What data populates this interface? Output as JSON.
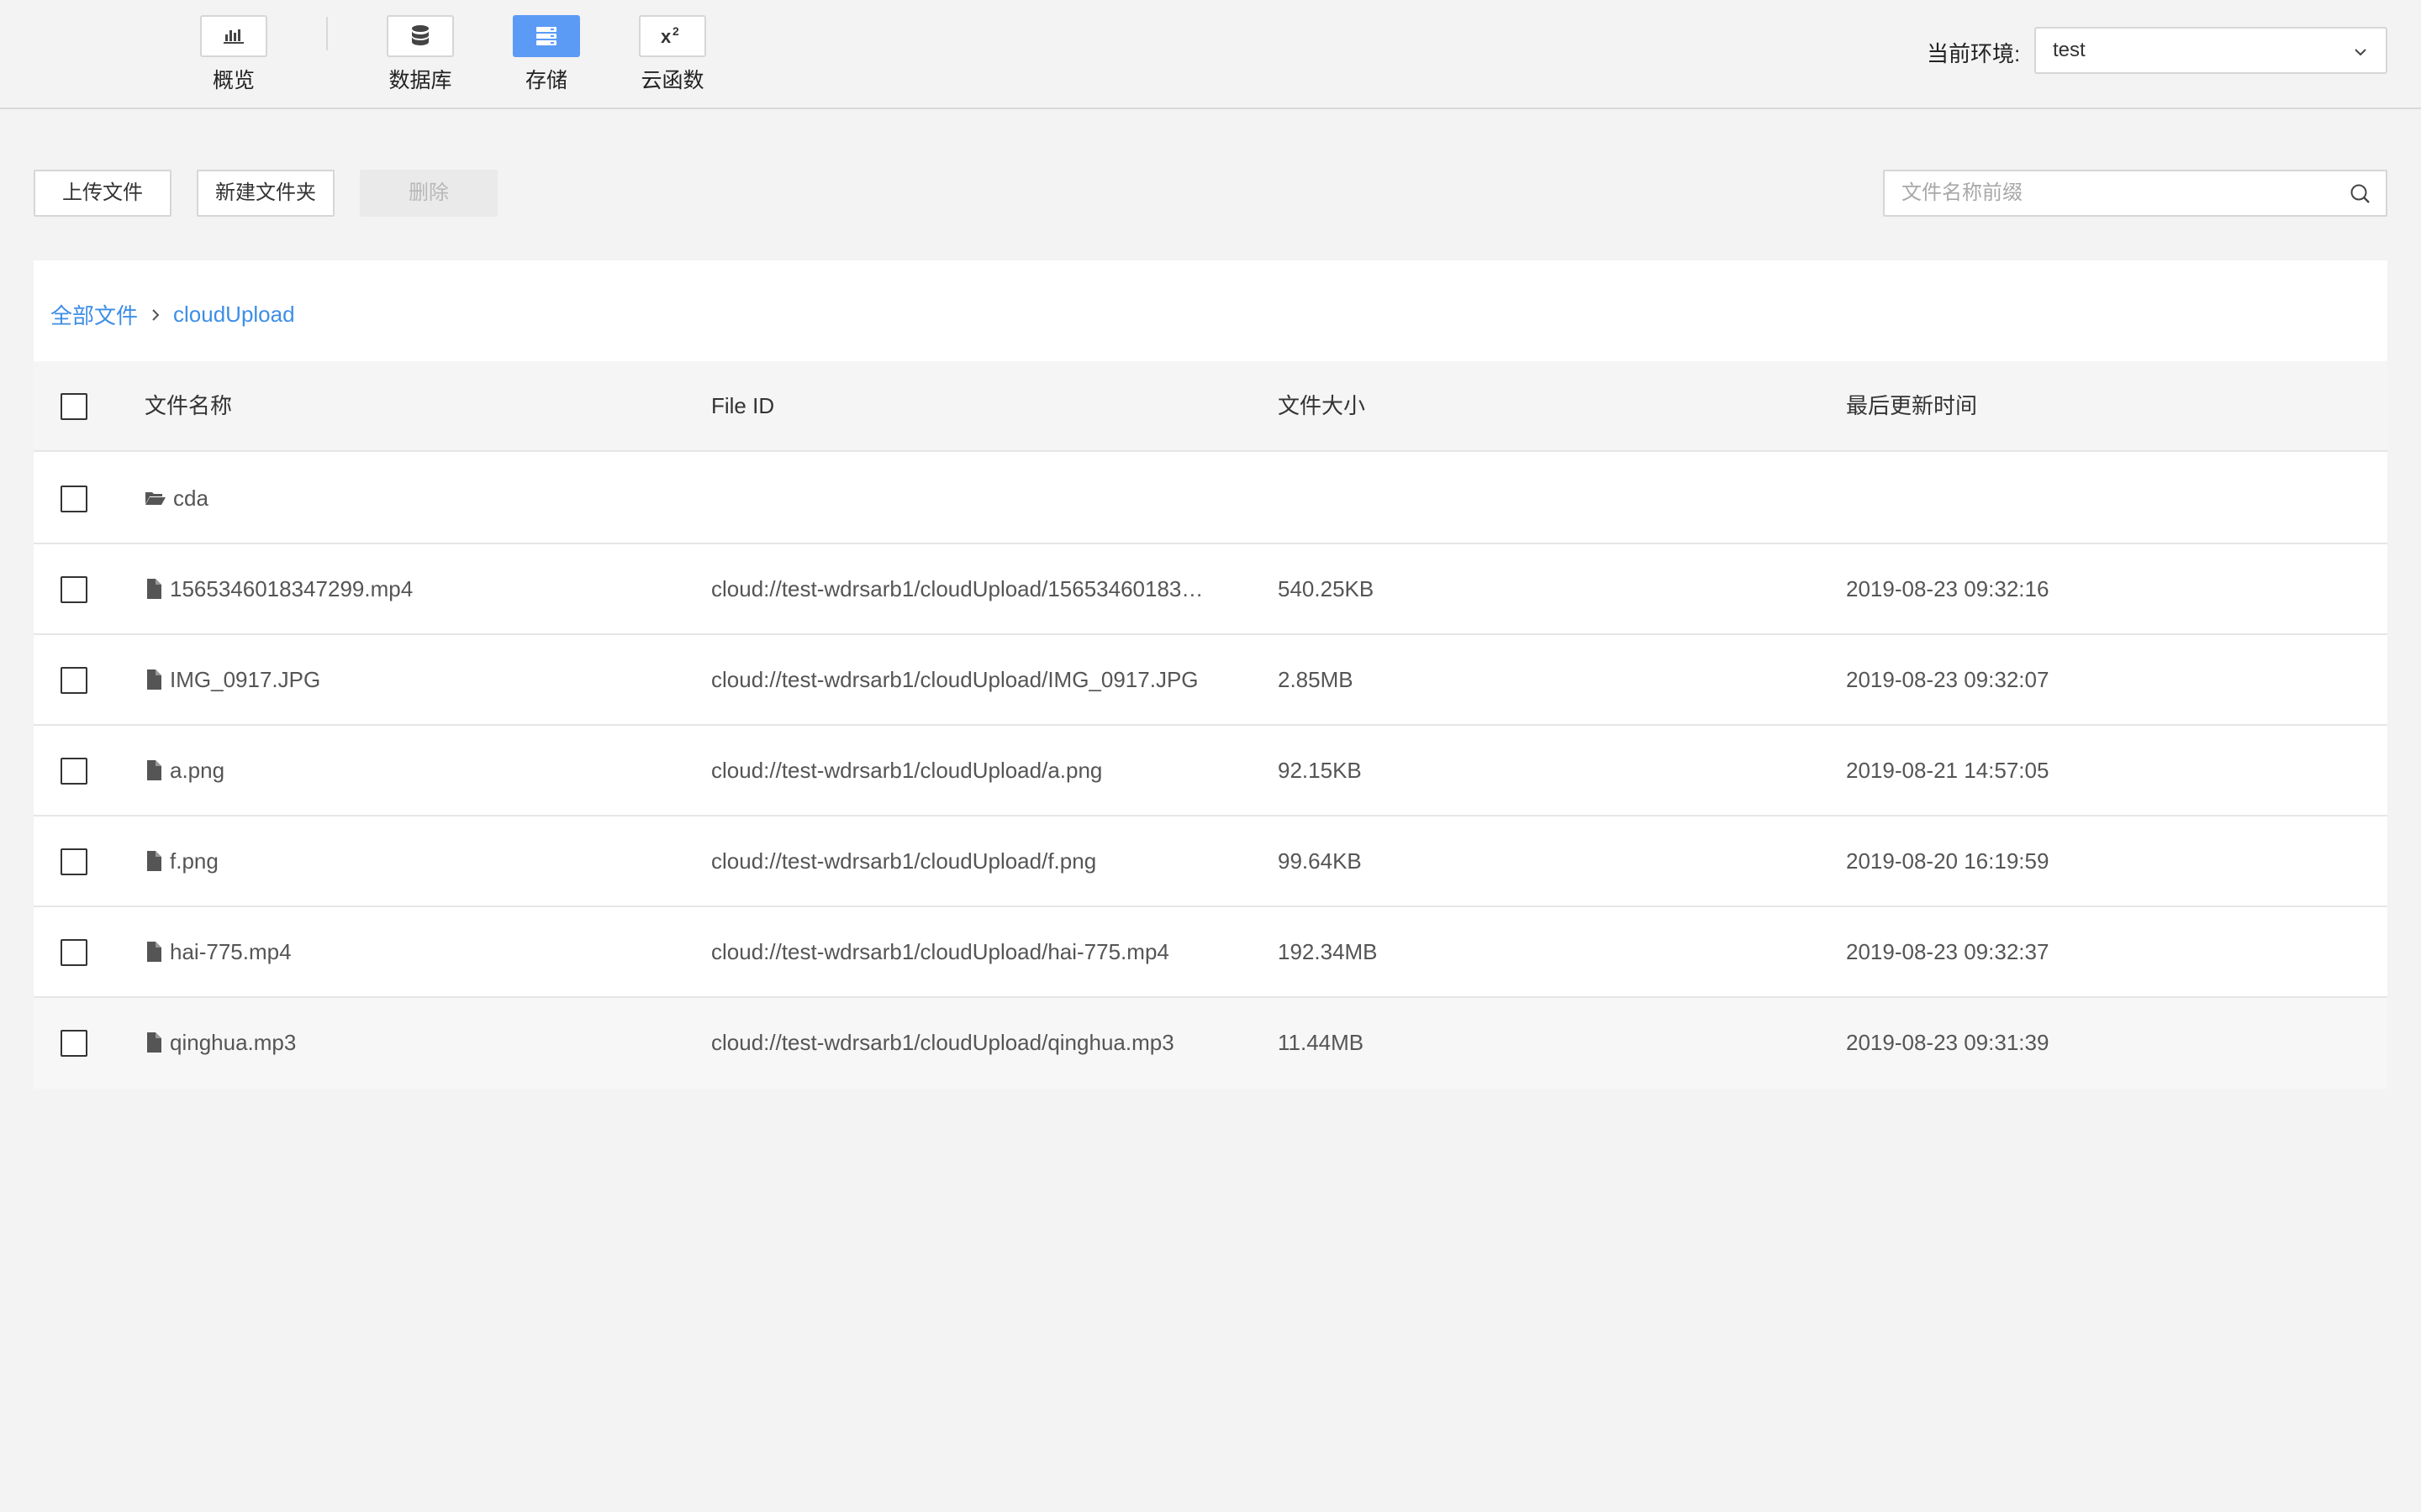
{
  "toolbar": {
    "items": [
      {
        "label": "概览",
        "icon": "chart-icon"
      },
      {
        "label": "数据库",
        "icon": "database-icon"
      },
      {
        "label": "存储",
        "icon": "storage-icon",
        "active": true
      },
      {
        "label": "云函数",
        "icon": "function-icon"
      }
    ],
    "env_label": "当前环境:",
    "env_value": "test"
  },
  "actions": {
    "upload": "上传文件",
    "new_folder": "新建文件夹",
    "delete": "删除",
    "search_placeholder": "文件名称前缀"
  },
  "breadcrumb": {
    "root": "全部文件",
    "current": "cloudUpload"
  },
  "table": {
    "columns": [
      "文件名称",
      "File ID",
      "文件大小",
      "最后更新时间"
    ],
    "rows": [
      {
        "type": "folder",
        "name": "cda",
        "id": "",
        "size": "",
        "time": ""
      },
      {
        "type": "file",
        "name": "1565346018347299.mp4",
        "id": "cloud://test-wdrsarb1/cloudUpload/15653460183…",
        "size": "540.25KB",
        "time": "2019-08-23 09:32:16"
      },
      {
        "type": "file",
        "name": "IMG_0917.JPG",
        "id": "cloud://test-wdrsarb1/cloudUpload/IMG_0917.JPG",
        "size": "2.85MB",
        "time": "2019-08-23 09:32:07"
      },
      {
        "type": "file",
        "name": "a.png",
        "id": "cloud://test-wdrsarb1/cloudUpload/a.png",
        "size": "92.15KB",
        "time": "2019-08-21 14:57:05"
      },
      {
        "type": "file",
        "name": "f.png",
        "id": "cloud://test-wdrsarb1/cloudUpload/f.png",
        "size": "99.64KB",
        "time": "2019-08-20 16:19:59"
      },
      {
        "type": "file",
        "name": "hai-775.mp4",
        "id": "cloud://test-wdrsarb1/cloudUpload/hai-775.mp4",
        "size": "192.34MB",
        "time": "2019-08-23 09:32:37"
      },
      {
        "type": "file",
        "name": "qinghua.mp3",
        "id": "cloud://test-wdrsarb1/cloudUpload/qinghua.mp3",
        "size": "11.44MB",
        "time": "2019-08-23 09:31:39"
      }
    ]
  },
  "colors": {
    "accent": "#5b9bf6",
    "link": "#3d8ee6"
  }
}
